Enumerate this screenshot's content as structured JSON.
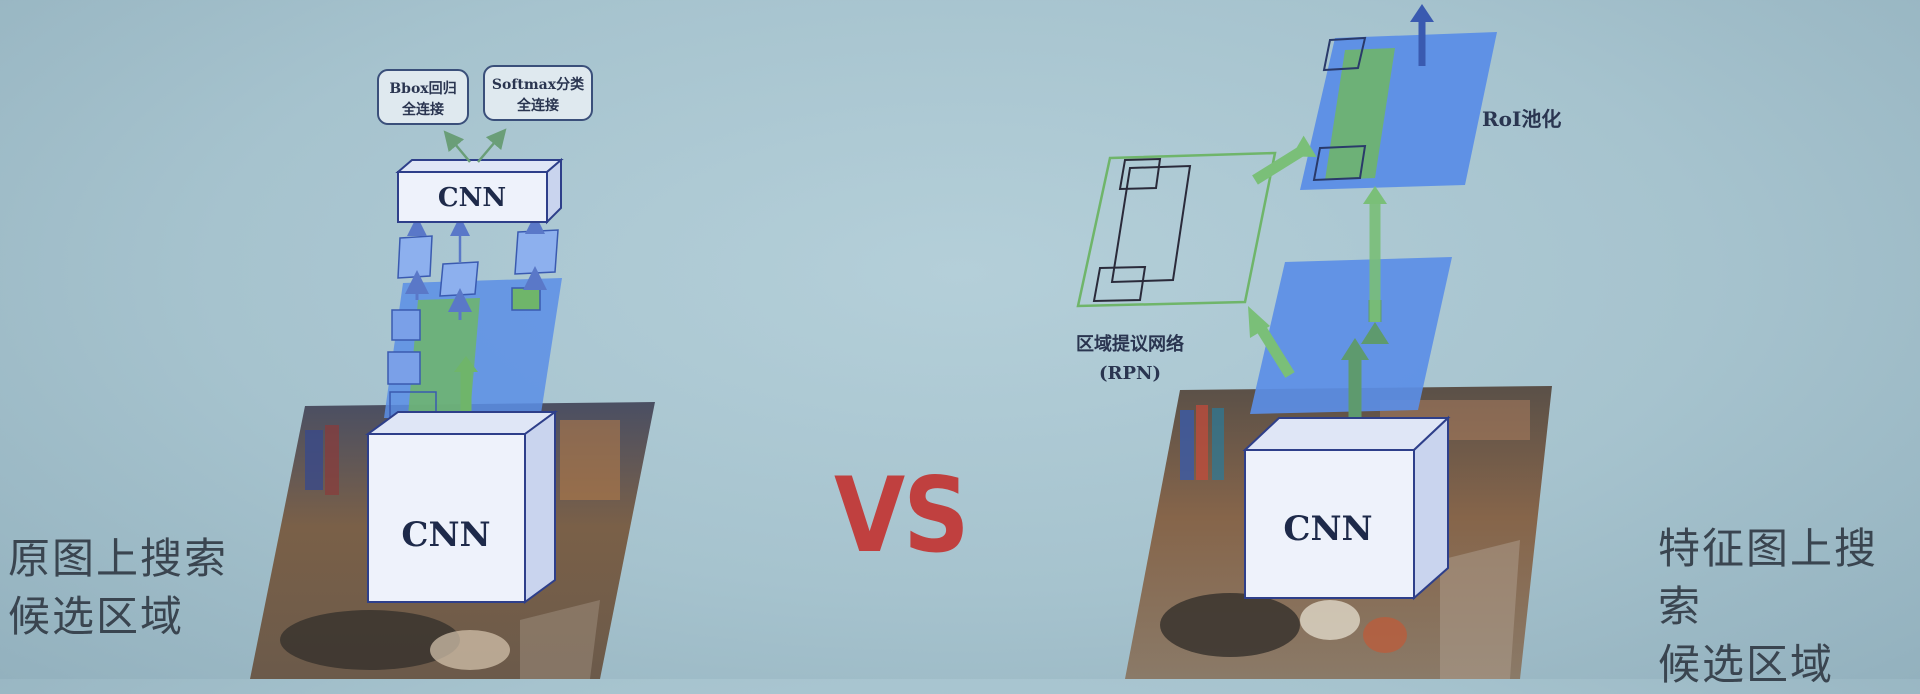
{
  "left": {
    "caption_line1": "原图上搜索",
    "caption_line2": "候选区域",
    "cnn_bottom": "CNN",
    "cnn_top": "CNN",
    "bbox_line1": "Bbox回归",
    "bbox_line2": "全连接",
    "softmax_line1": "Softmax分类",
    "softmax_line2": "全连接"
  },
  "center": {
    "vs": "VS"
  },
  "right": {
    "cnn": "CNN",
    "roi_label": "RoI池化",
    "rpn_line1": "区域提议网络",
    "rpn_line2": "(RPN)",
    "caption_line1": "特征图上搜索",
    "caption_line2": "候选区域"
  },
  "colors": {
    "feature_map_blue": "#5b8ee6",
    "region_green": "#6fb56a",
    "vs_red": "#c0403f",
    "cube_face": "#eef2fb",
    "cube_edge": "#2e3f8a"
  }
}
